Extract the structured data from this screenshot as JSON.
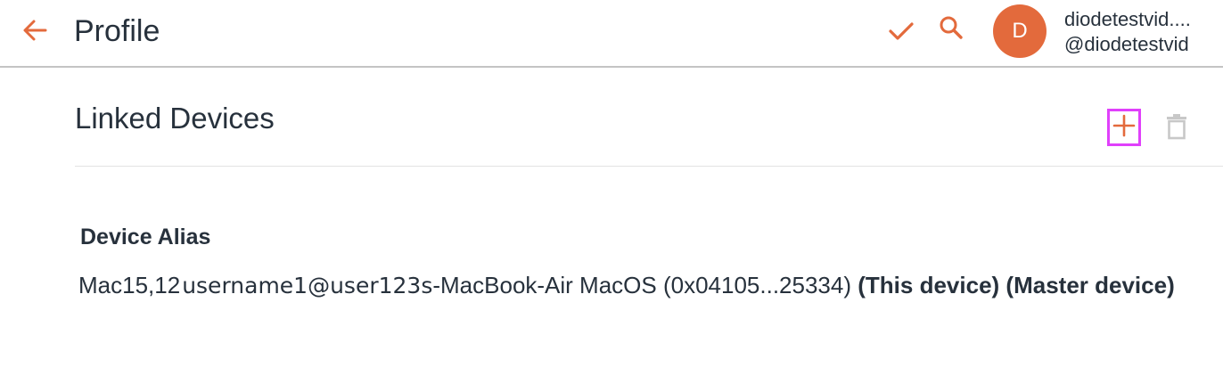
{
  "header": {
    "title": "Profile",
    "back_icon": "arrow-left-icon",
    "confirm_icon": "checkmark-icon",
    "search_icon": "search-icon",
    "accent_color": "#e36a3c"
  },
  "account": {
    "avatar_letter": "D",
    "display_name": "diodetestvid....",
    "handle": "@diodetestvid"
  },
  "section": {
    "title": "Linked Devices",
    "add_icon": "plus-icon",
    "delete_icon": "trash-icon"
  },
  "table": {
    "column_header": "Device Alias",
    "rows": [
      {
        "model": "Mac15,12",
        "user": "username1@user123s",
        "host_os": "-MacBook-Air MacOS (0x04105...25334)",
        "this_device": "(This device)",
        "master_device": "(Master device)"
      }
    ]
  }
}
